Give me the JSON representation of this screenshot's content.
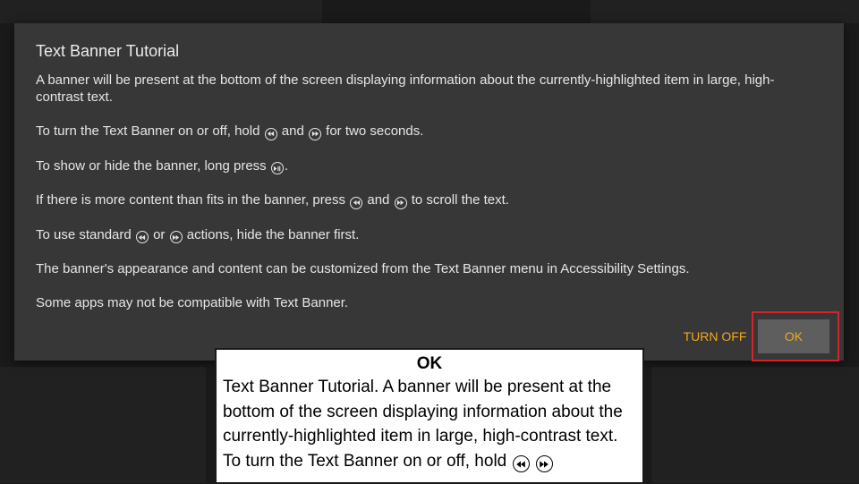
{
  "dialog": {
    "title": "Text Banner Tutorial",
    "paragraphs": [
      "A banner will be present at the bottom of the screen displaying information about the currently-highlighted item in large, high-contrast text.",
      [
        "To turn the Text Banner on or off, hold ",
        " and ",
        " for two seconds."
      ],
      [
        "To show or hide the banner, long press ",
        "."
      ],
      [
        "If there is more content than fits in the banner, press ",
        " and ",
        " to scroll the text."
      ],
      [
        "To use standard ",
        " or ",
        " actions, hide the banner first."
      ],
      "The banner's appearance and content can be customized from the Text Banner menu in Accessibility Settings.",
      "Some apps may not be compatible with Text Banner."
    ],
    "buttons": {
      "turn_off": "TURN OFF",
      "ok": "OK"
    }
  },
  "text_banner": {
    "title": "OK",
    "body": "Text Banner Tutorial. A banner will be present at the bottom of the screen displaying information about the currently-highlighted item in large, high-contrast text.  To turn the Text Banner on or off, hold"
  },
  "icons": {
    "rewind": "rewind-icon",
    "fast_forward": "fast-forward-icon",
    "play_pause": "play-pause-icon"
  },
  "colors": {
    "accent": "#f2a81d",
    "dialog_bg": "#373737",
    "focus_ring": "#d3232f",
    "ok_button_bg": "#5e5e5e"
  }
}
